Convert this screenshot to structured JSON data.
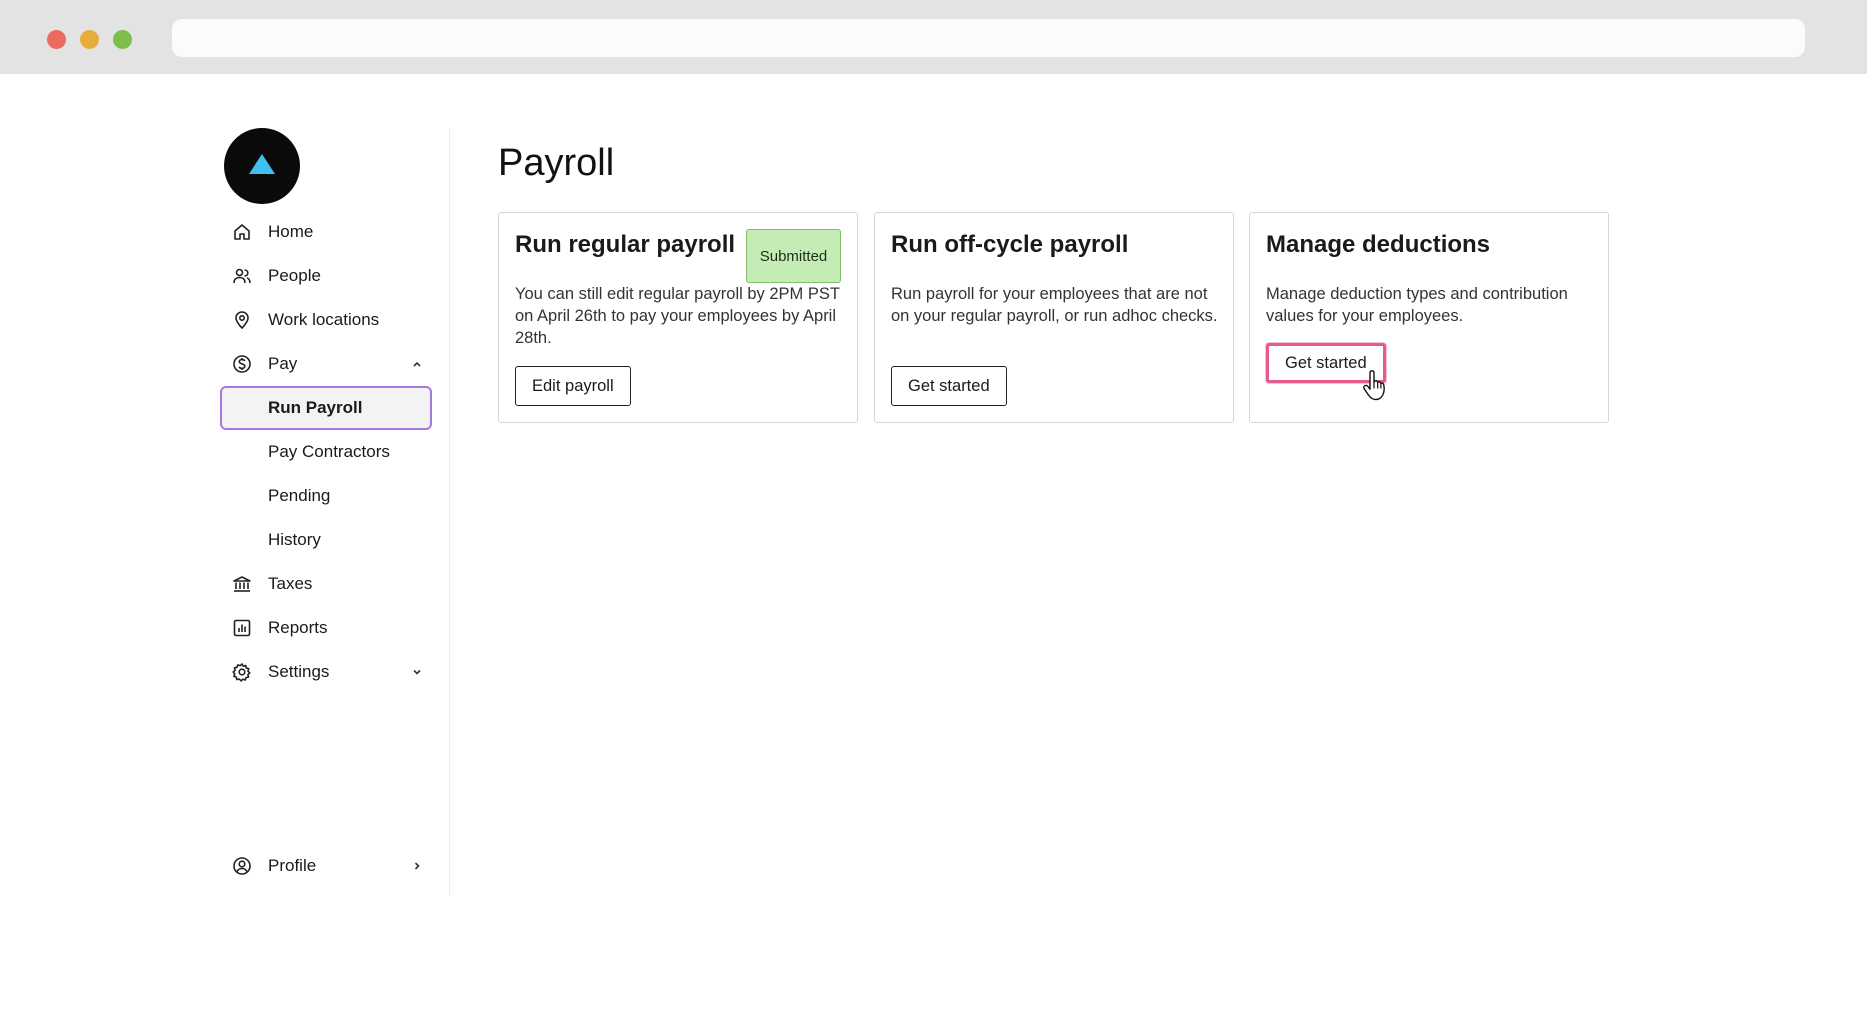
{
  "page": {
    "title": "Payroll"
  },
  "sidebar": {
    "items": [
      {
        "label": "Home",
        "icon": "home-icon"
      },
      {
        "label": "People",
        "icon": "people-icon"
      },
      {
        "label": "Work locations",
        "icon": "location-pin-icon"
      },
      {
        "label": "Pay",
        "icon": "dollar-circle-icon",
        "expanded": true
      },
      {
        "label": "Run Payroll",
        "active": true
      },
      {
        "label": "Pay Contractors"
      },
      {
        "label": "Pending"
      },
      {
        "label": "History"
      },
      {
        "label": "Taxes",
        "icon": "bank-icon"
      },
      {
        "label": "Reports",
        "icon": "bar-chart-icon"
      },
      {
        "label": "Settings",
        "icon": "gear-icon",
        "expanded": false
      }
    ],
    "profile": {
      "label": "Profile",
      "icon": "user-circle-icon"
    }
  },
  "cards": [
    {
      "title": "Run regular payroll",
      "badge": "Submitted",
      "description": "You can still edit regular payroll by 2PM PST on April 26th to pay your employees by April 28th.",
      "button": "Edit payroll"
    },
    {
      "title": "Run off-cycle payroll",
      "description": "Run payroll for your employees that are not on your regular payroll, or run adhoc checks.",
      "button": "Get started"
    },
    {
      "title": "Manage deductions",
      "description": "Manage deduction types and contribution values for your employees.",
      "button": "Get started"
    }
  ],
  "colors": {
    "active_border": "#a57ae0",
    "focus_border": "#e85a8f",
    "badge_bg": "#c4ecb4",
    "logo_triangle": "#3fc1f0"
  }
}
